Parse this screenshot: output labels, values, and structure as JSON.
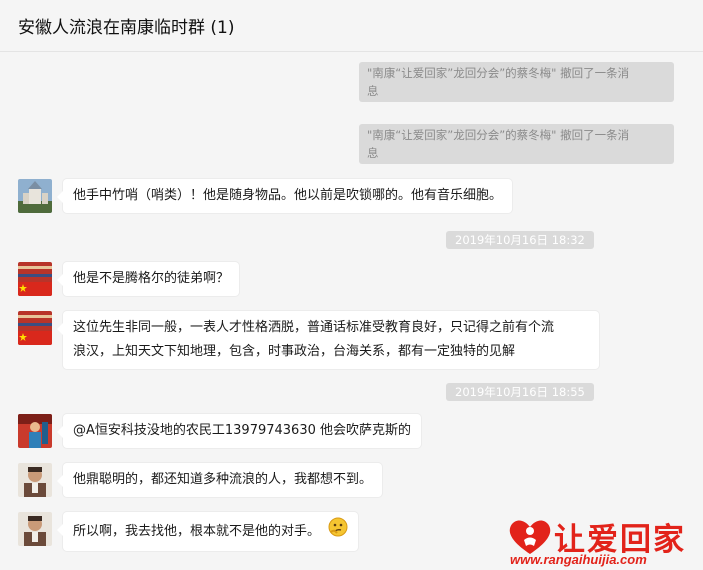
{
  "header": {
    "title": "安徽人流浪在南康临时群 (1)"
  },
  "messages": {
    "sys1": "“南康“让爱回家”龙回分会”的蔡冬梅\" 撤回了一条消息",
    "sys1_prefix": "\"",
    "sys1_a": " \"南康“让爱回家”龙回分会”的蔡冬梅\" 撤回了一条消",
    "sys1_b": "息",
    "sys2_a": " \"南康“让爱回家”龙回分会”的蔡冬梅\" 撤回了一条消",
    "sys2_b": "息",
    "m1": "他手中竹哨（哨类）！他是随身物品。他以前是吹锁哪的。他有音乐细胞。",
    "time1": "2019年10月16日 18:32",
    "m2": "他是不是腾格尔的徒弟啊？",
    "m3_a": "这位先生非同一般，一表人才性格洒脱，普通话标准受教育良好，只记得之前有个流",
    "m3_b": "浪汉，上知天文下知地理，包含，时事政治，台海关系，都有一定独特的见解",
    "time2": "2019年10月16日 18:55",
    "m4": "@A恒安科技没地的农民工13979743630 他会吹萨克斯的",
    "m5": "他鼎聪明的，都还知道多种流浪的人，我都想不到。",
    "m6": "所以啊，我去找他，根本就不是他的对手。"
  },
  "watermark": {
    "name": "让爱回家",
    "url": "www.rangaihuijia.com"
  },
  "colors": {
    "brand_red": "#e2231a",
    "bubble": "#ffffff",
    "background": "#f5f5f5"
  }
}
